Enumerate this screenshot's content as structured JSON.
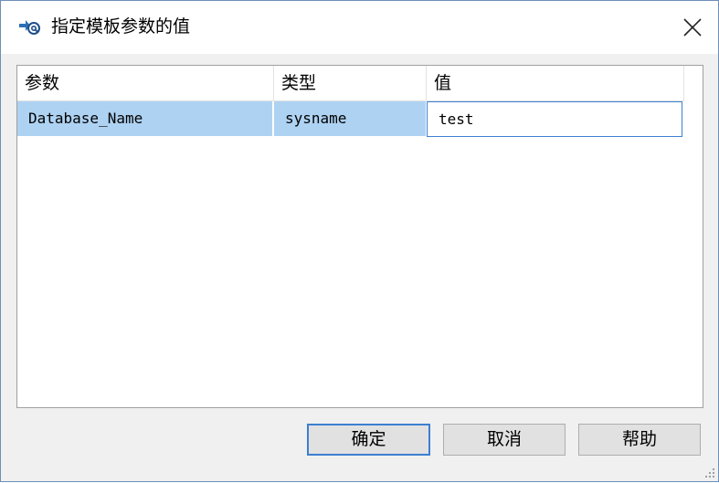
{
  "window": {
    "title": "指定模板参数的值",
    "close_glyph": "✕"
  },
  "grid": {
    "columns": [
      "参数",
      "类型",
      "值"
    ],
    "rows": [
      {
        "parameter": "Database_Name",
        "type": "sysname",
        "value": "test"
      }
    ]
  },
  "buttons": {
    "ok": "确定",
    "cancel": "取消",
    "help": "帮助"
  },
  "colors": {
    "selected_row": "#aed2f2",
    "focus_border": "#3c7fd1",
    "button_face": "#e1e1e1",
    "dialog_bg": "#f0f0f0"
  }
}
